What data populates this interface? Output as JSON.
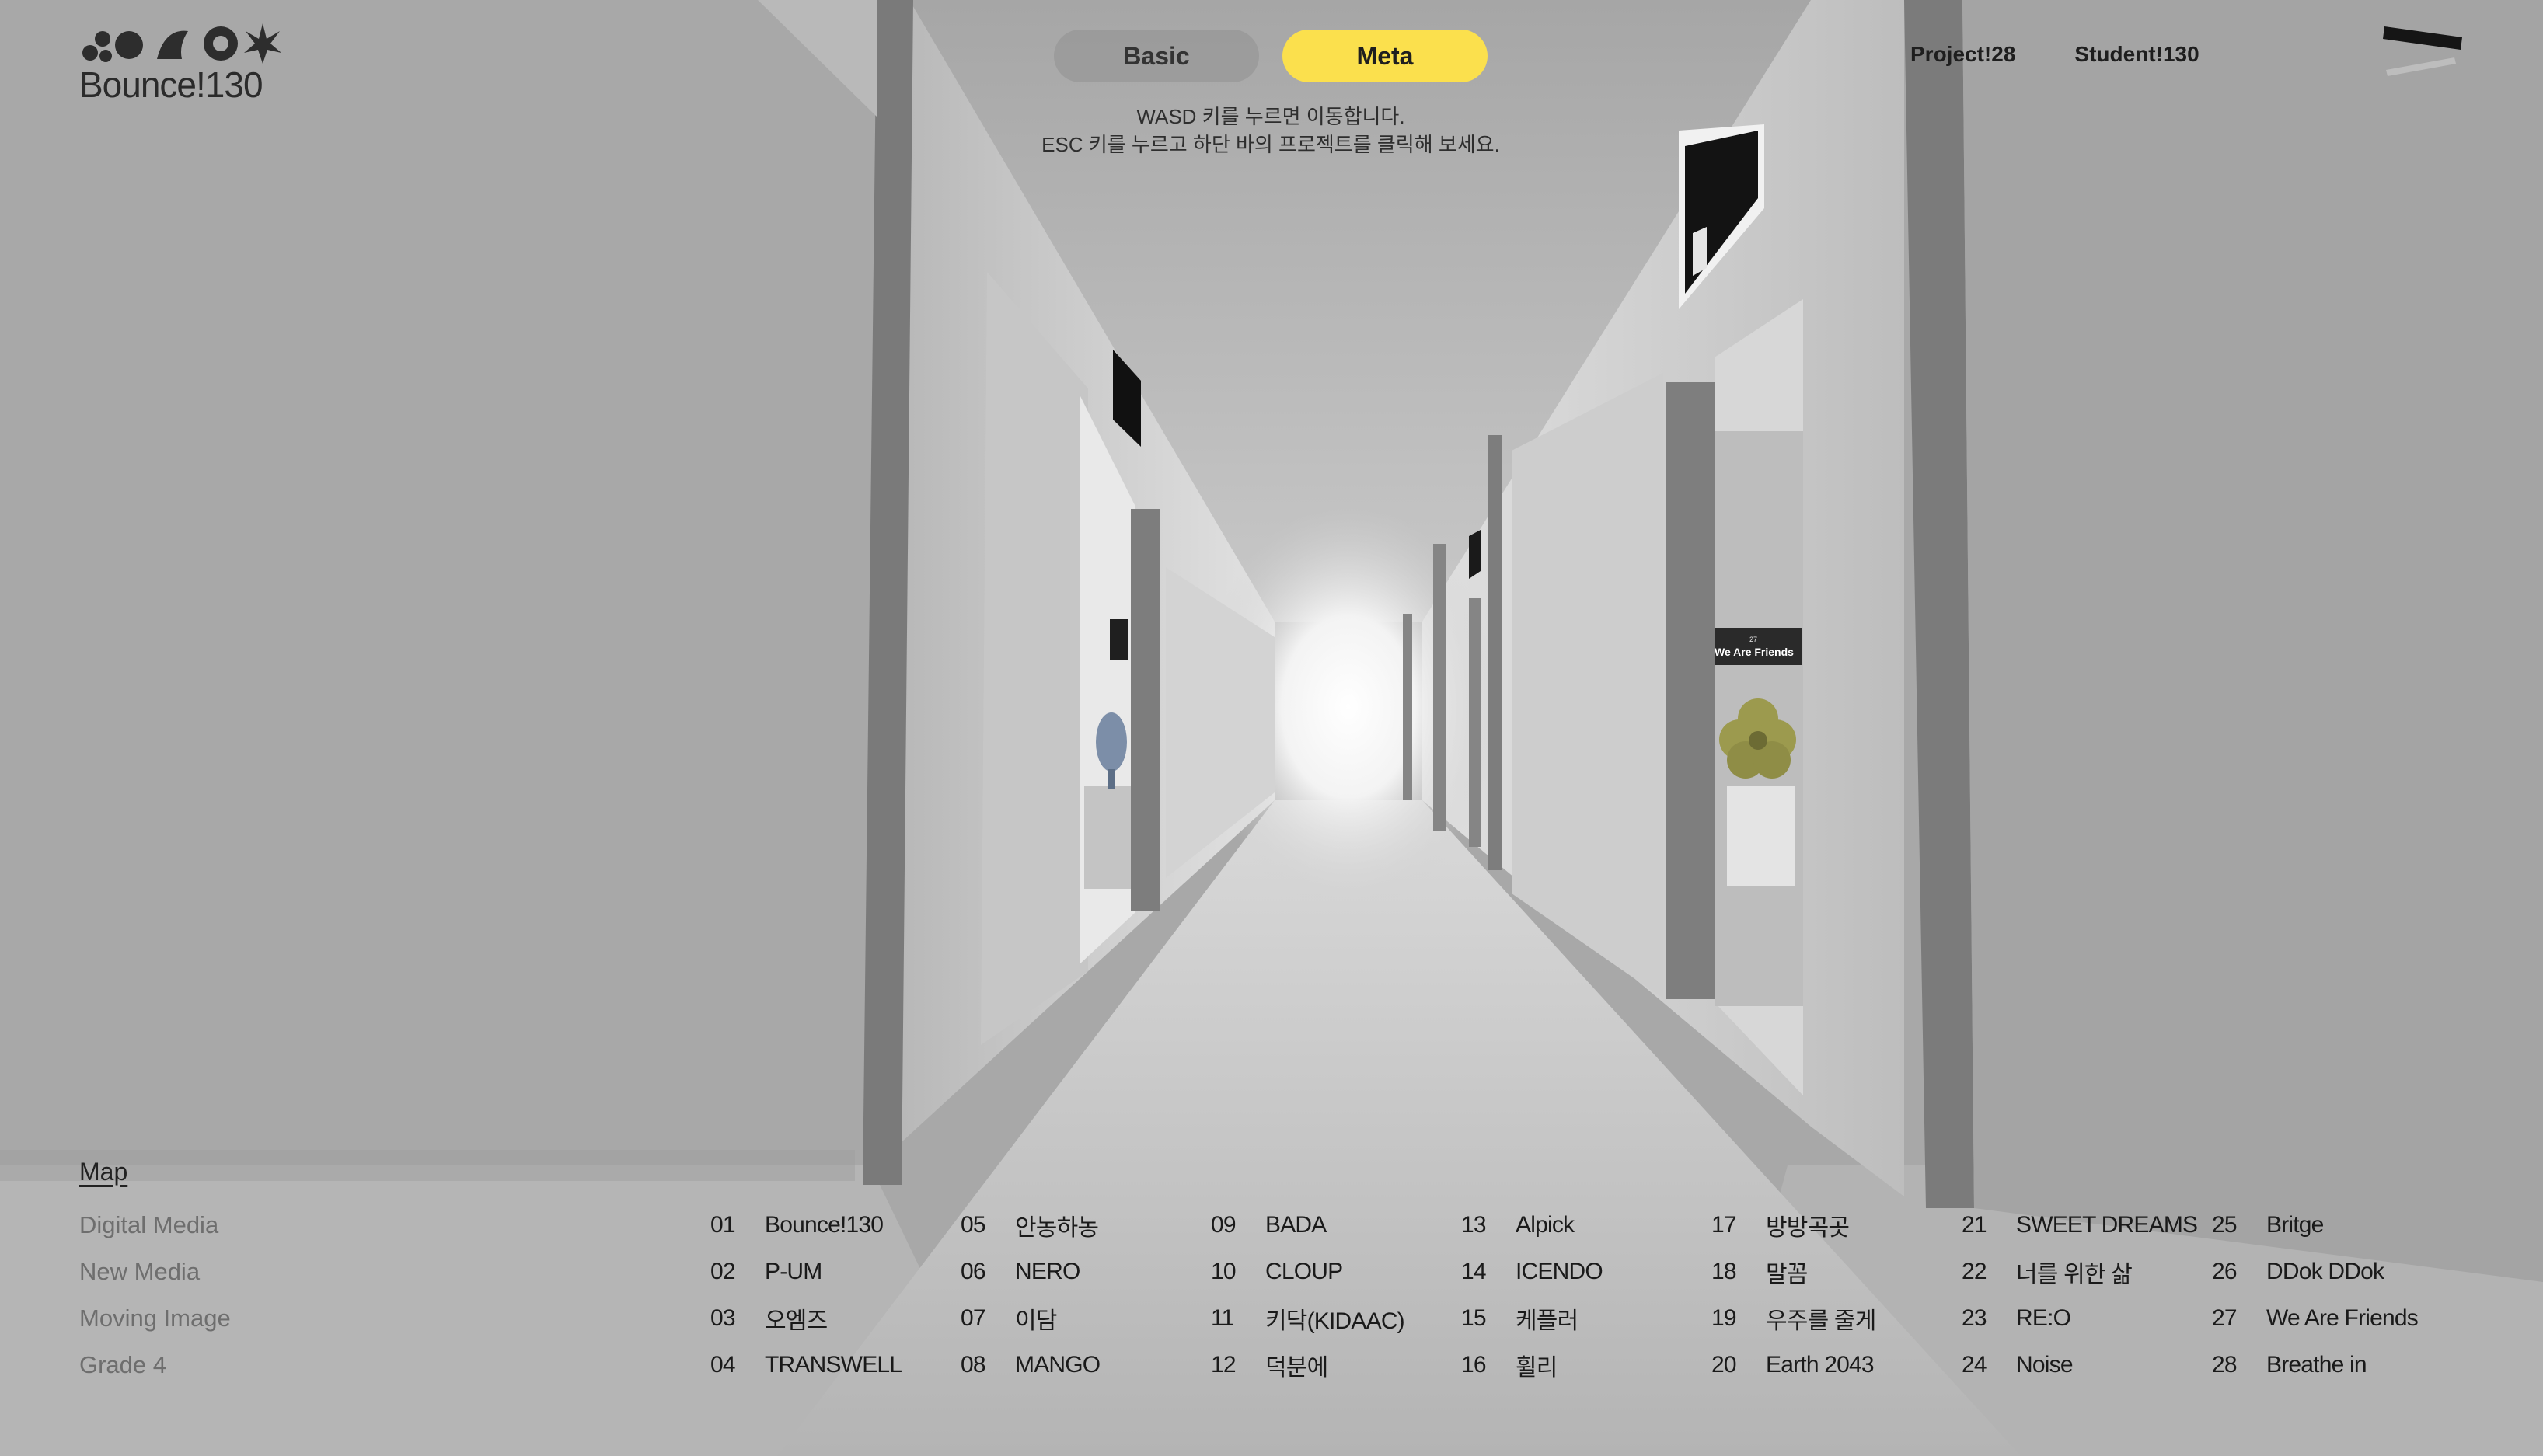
{
  "logo": {
    "text": "Bounce!130"
  },
  "mode_toggle": {
    "basic_label": "Basic",
    "meta_label": "Meta",
    "active": "Meta"
  },
  "hint": {
    "line1": "WASD 키를 누르면 이동합니다.",
    "line2": "ESC 키를 누르고 하단 바의 프로젝트를 클릭해 보세요."
  },
  "stats": {
    "projects": "Project!28",
    "students": "Student!130"
  },
  "scene": {
    "sign_right": {
      "line1": "27",
      "line2": "We Are Friends"
    }
  },
  "map": {
    "title": "Map",
    "categories": [
      "Digital Media",
      "New Media",
      "Moving Image",
      "Grade 4"
    ],
    "projects": [
      {
        "num": "01",
        "name": "Bounce!130"
      },
      {
        "num": "02",
        "name": "P-UM"
      },
      {
        "num": "03",
        "name": "오엠즈"
      },
      {
        "num": "04",
        "name": "TRANSWELL"
      },
      {
        "num": "05",
        "name": "안농하농"
      },
      {
        "num": "06",
        "name": "NERO"
      },
      {
        "num": "07",
        "name": "이담"
      },
      {
        "num": "08",
        "name": "MANGO"
      },
      {
        "num": "09",
        "name": "BADA"
      },
      {
        "num": "10",
        "name": "CLOUP"
      },
      {
        "num": "11",
        "name": "키닥(KIDAAC)"
      },
      {
        "num": "12",
        "name": "덕분에"
      },
      {
        "num": "13",
        "name": "Alpick"
      },
      {
        "num": "14",
        "name": "ICENDO"
      },
      {
        "num": "15",
        "name": "케플러"
      },
      {
        "num": "16",
        "name": "휠리"
      },
      {
        "num": "17",
        "name": "방방곡곳"
      },
      {
        "num": "18",
        "name": "말꼼"
      },
      {
        "num": "19",
        "name": "우주를 줄게"
      },
      {
        "num": "20",
        "name": "Earth 2043"
      },
      {
        "num": "21",
        "name": "SWEET DREAMS"
      },
      {
        "num": "22",
        "name": "너를 위한 삶"
      },
      {
        "num": "23",
        "name": "RE:O"
      },
      {
        "num": "24",
        "name": "Noise"
      },
      {
        "num": "25",
        "name": "Britge"
      },
      {
        "num": "26",
        "name": "DDok DDok"
      },
      {
        "num": "27",
        "name": "We Are Friends"
      },
      {
        "num": "28",
        "name": "Breathe in"
      }
    ]
  }
}
